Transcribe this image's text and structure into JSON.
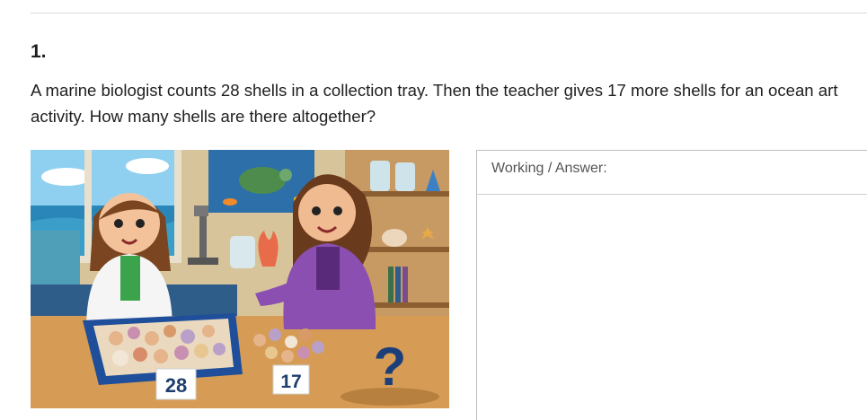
{
  "question": {
    "number": "1.",
    "text": "A marine biologist counts 28 shells in a collection tray. Then the teacher gives 17 more shells for an ocean art activity. How many shells are there altogether?"
  },
  "illustration": {
    "card_left": "28",
    "card_right": "17",
    "unknown": "?"
  },
  "answer_box": {
    "label": "Working / Answer:"
  }
}
